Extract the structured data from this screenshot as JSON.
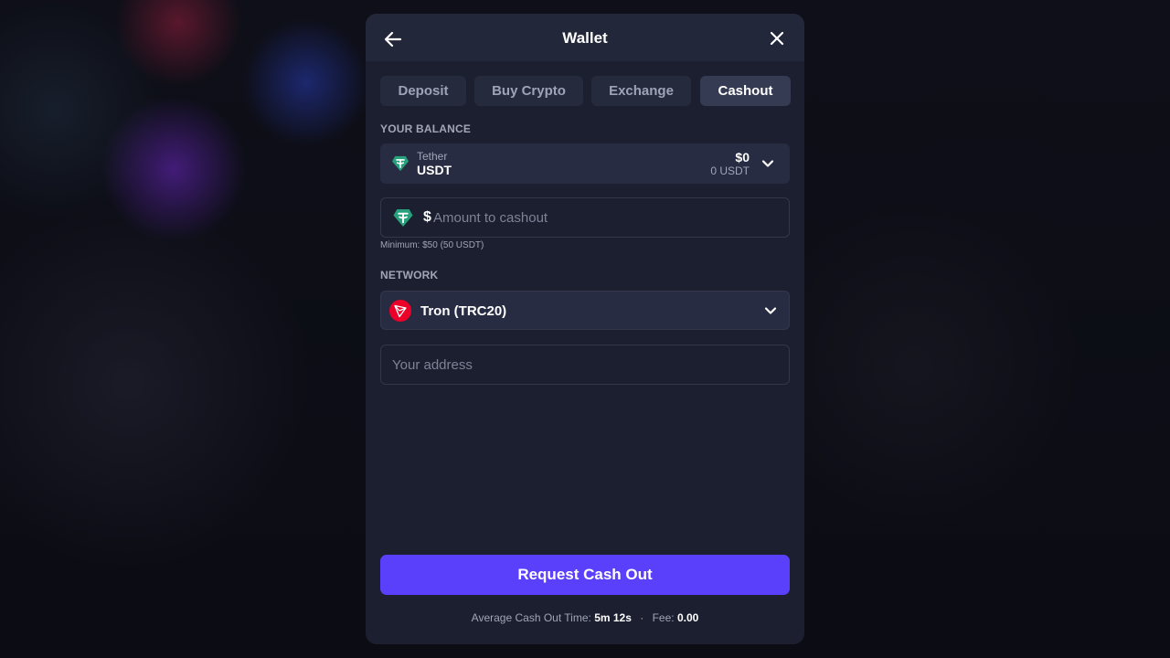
{
  "modal": {
    "title": "Wallet",
    "back_icon": "arrow-left-icon",
    "close_icon": "close-icon"
  },
  "tabs": [
    {
      "label": "Deposit",
      "active": false
    },
    {
      "label": "Buy Crypto",
      "active": false
    },
    {
      "label": "Exchange",
      "active": false
    },
    {
      "label": "Cashout",
      "active": true
    }
  ],
  "balance": {
    "section_label": "YOUR BALANCE",
    "coin_name": "Tether",
    "coin_ticker": "USDT",
    "usd_value": "$0",
    "coin_value": "0 USDT",
    "icon": "tether-icon"
  },
  "amount": {
    "currency_symbol": "$",
    "placeholder": "Amount to cashout",
    "value": "",
    "minimum_note": "Minimum: $50 (50 USDT)"
  },
  "network": {
    "section_label": "NETWORK",
    "selected": "Tron (TRC20)",
    "icon": "tron-icon"
  },
  "address": {
    "placeholder": "Your address",
    "value": ""
  },
  "submit": {
    "label": "Request Cash Out"
  },
  "footer": {
    "time_label": "Average Cash Out Time:",
    "time_value": "5m 12s",
    "separator": "·",
    "fee_label": "Fee:",
    "fee_value": "0.00"
  },
  "colors": {
    "accent": "#5a3ffb",
    "modal_bg": "#1c1f2f",
    "tether": "#26a17b",
    "tron": "#eb0029"
  }
}
